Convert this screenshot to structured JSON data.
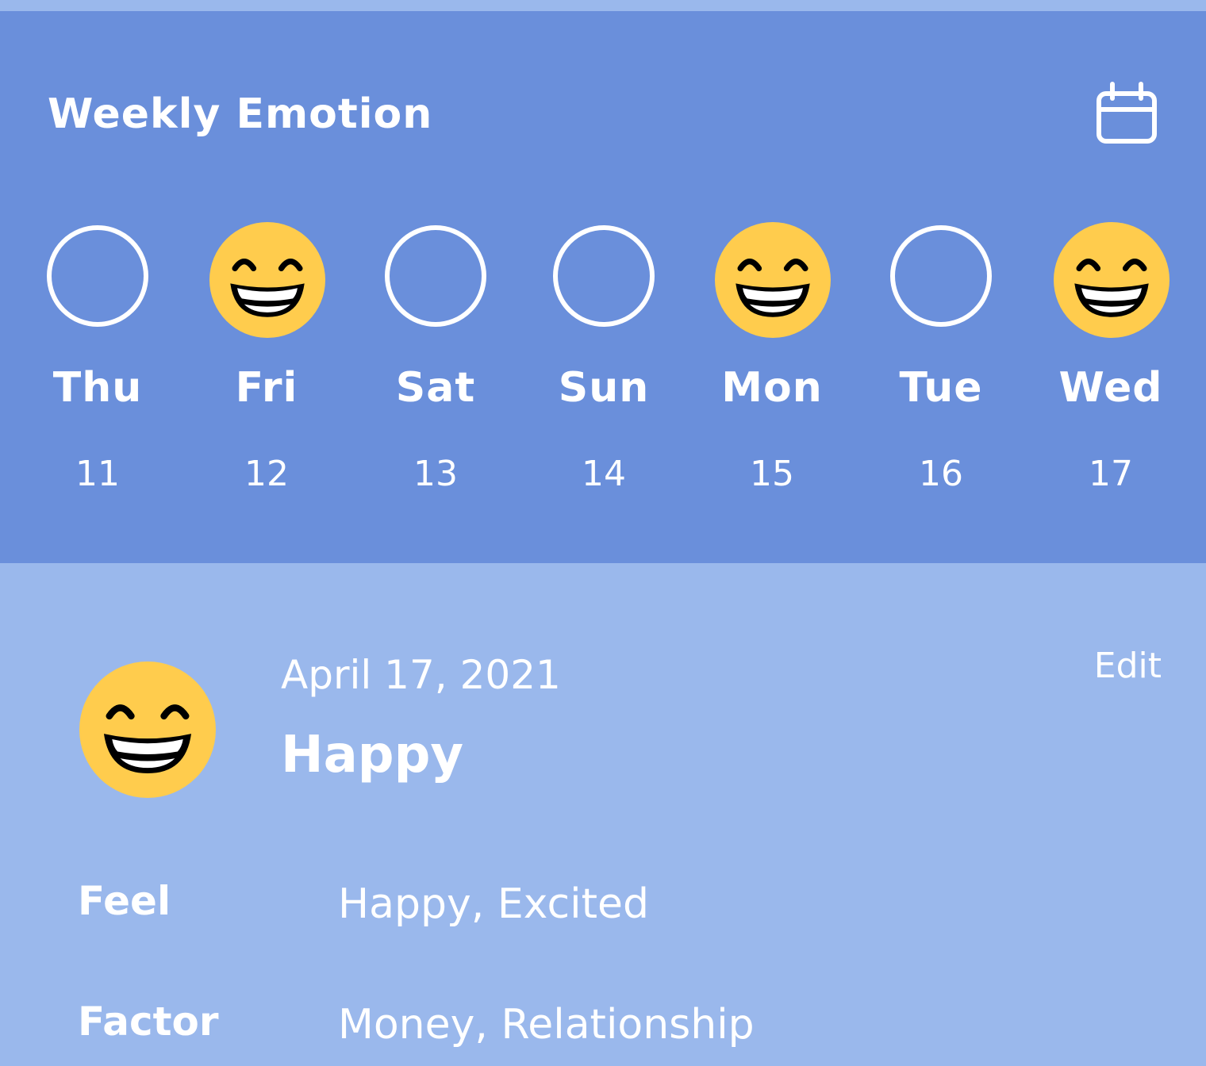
{
  "header": {
    "title": "Weekly Emotion",
    "calendar_icon": "calendar-icon",
    "background": "#6A8FDB"
  },
  "week": {
    "days": [
      {
        "name": "Thu",
        "date": "11",
        "emoji": null
      },
      {
        "name": "Fri",
        "date": "12",
        "emoji": "grinning-face-with-smiling-eyes"
      },
      {
        "name": "Sat",
        "date": "13",
        "emoji": null
      },
      {
        "name": "Sun",
        "date": "14",
        "emoji": null
      },
      {
        "name": "Mon",
        "date": "15",
        "emoji": "grinning-face-with-smiling-eyes"
      },
      {
        "name": "Tue",
        "date": "16",
        "emoji": null
      },
      {
        "name": "Wed",
        "date": "17",
        "emoji": "grinning-face-with-smiling-eyes"
      }
    ]
  },
  "detail": {
    "date": "April 17, 2021",
    "mood": "Happy",
    "emoji": "grinning-face-with-smiling-eyes",
    "edit_label": "Edit",
    "background": "#9AB8EC",
    "rows": [
      {
        "label": "Feel",
        "value": "Happy, Excited"
      },
      {
        "label": "Factor",
        "value": "Money, Relationship"
      }
    ]
  },
  "colors": {
    "emoji_yellow": "#FFCC4D",
    "text": "#FFFFFF"
  }
}
